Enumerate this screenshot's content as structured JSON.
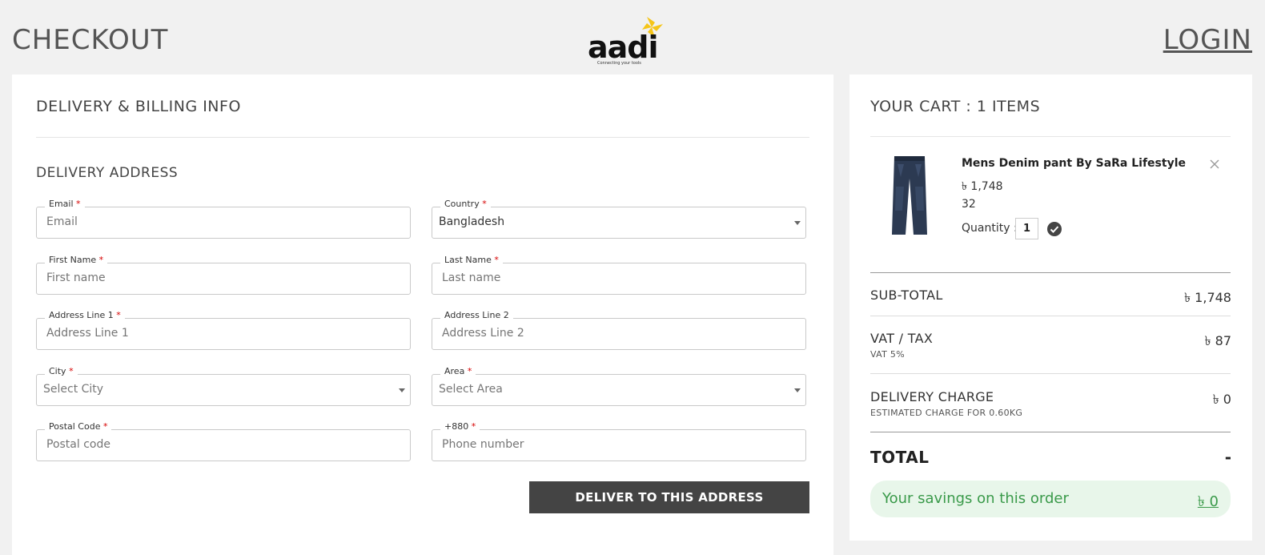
{
  "header": {
    "title": "CHECKOUT",
    "login": "LOGIN",
    "logo_text": "aadi",
    "logo_tagline": "Connecting your tools"
  },
  "form": {
    "title": "DELIVERY & BILLING INFO",
    "section": "DELIVERY ADDRESS",
    "fields": {
      "email": {
        "label": "Email",
        "placeholder": "Email"
      },
      "country": {
        "label": "Country",
        "value": "Bangladesh"
      },
      "first_name": {
        "label": "First Name",
        "placeholder": "First name"
      },
      "last_name": {
        "label": "Last Name",
        "placeholder": "Last name"
      },
      "address1": {
        "label": "Address Line 1",
        "placeholder": "Address Line 1"
      },
      "address2": {
        "label": "Address Line 2",
        "placeholder": "Address Line 2"
      },
      "city": {
        "label": "City",
        "placeholder": "Select City"
      },
      "area": {
        "label": "Area",
        "placeholder": "Select Area"
      },
      "postal": {
        "label": "Postal Code",
        "placeholder": "Postal code"
      },
      "phone": {
        "label": "+880",
        "placeholder": "Phone number"
      }
    },
    "required_mark": "*",
    "submit_label": "DELIVER TO THIS ADDRESS"
  },
  "cart": {
    "title": "YOUR CART : 1 ITEMS",
    "item": {
      "name": "Mens Denim pant By SaRa Lifestyle",
      "price": "৳ 1,748",
      "size": "32",
      "quantity_label": "Quantity :",
      "quantity": "1",
      "image_icon": "jeans-image"
    },
    "summary": {
      "subtotal_label": "SUB-TOTAL",
      "subtotal_value": "৳ 1,748",
      "vat_label": "VAT / TAX",
      "vat_sub": "VAT 5%",
      "vat_value": "৳ 87",
      "delivery_label": "DELIVERY CHARGE",
      "delivery_sub": "ESTIMATED CHARGE FOR 0.60KG",
      "delivery_value": "৳ 0",
      "total_label": "TOTAL",
      "total_value": "-",
      "savings_label": "Your savings on this order",
      "savings_value": "৳ 0"
    }
  },
  "colors": {
    "background": "#f1f1f1",
    "button": "#444444",
    "savings_bg": "#e8f6ea",
    "savings_text": "#3a9a4a",
    "logo_accent": "#f5c518",
    "required": "#d60000"
  }
}
